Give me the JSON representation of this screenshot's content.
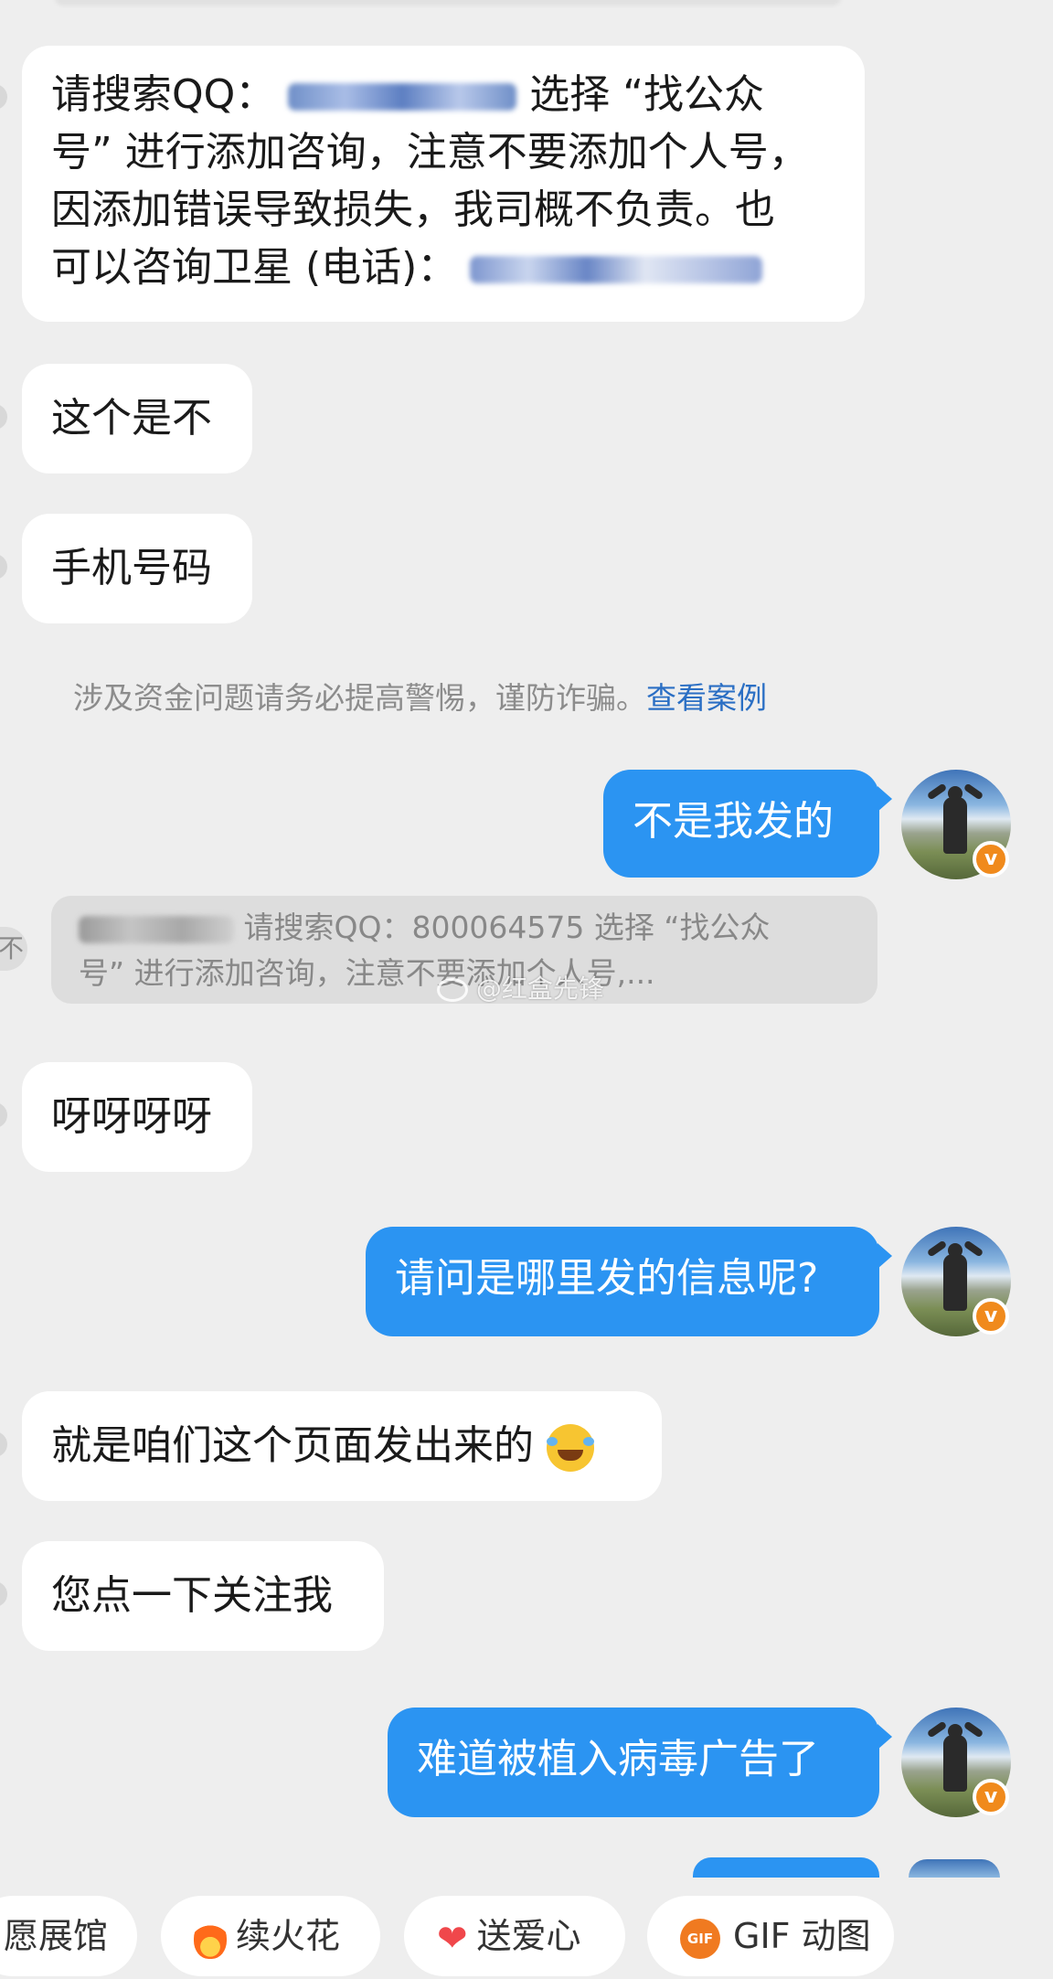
{
  "messages": {
    "m1": {
      "prefix": "请搜索QQ：",
      "mid": "选择 “找公众",
      "line2": "号” 进行添加咨询，注意不要添加个人号，",
      "line3": "因添加错误导致损失，我司概不负责。也",
      "line4": "可以咨询卫星 (电话)："
    },
    "m2": "这个是不",
    "m3": "手机号码",
    "m4": "不是我发的",
    "m5": "呀呀呀呀",
    "m6": "请问是哪里发的信息呢?",
    "m7": "就是咱们这个页面发出来的",
    "m8": "您点一下关注我",
    "m9": "难道被植入病毒广告了"
  },
  "notice": {
    "text": "涉及资金问题请务必提高警惕，谨防诈骗。",
    "link": "查看案例"
  },
  "quote": {
    "edge_text": "不",
    "line1": "请搜索QQ：800064575 选择 “找公众",
    "line2": "号” 进行添加咨询，注意不要添加个人号,..."
  },
  "watermark": "@红盒先锋",
  "quick_actions": [
    {
      "label": "愿展馆"
    },
    {
      "label": "续火花",
      "icon": "flame-icon"
    },
    {
      "label": "送爱心",
      "icon": "heart-icon"
    },
    {
      "label": "GIF 动图",
      "icon": "gif-icon",
      "icon_text": "GIF"
    }
  ],
  "colors": {
    "background": "#eeeeee",
    "incoming_bubble": "#ffffff",
    "outgoing_bubble": "#2b94f2",
    "link": "#2b6fc4",
    "verified_badge": "#f08a1c"
  }
}
